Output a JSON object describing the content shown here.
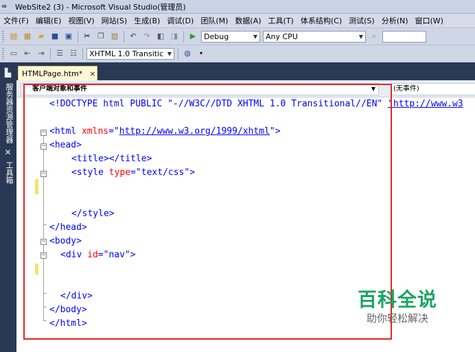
{
  "window": {
    "title": "WebSite2 (3) - Microsoft Visual Studio(管理员)"
  },
  "menu": [
    "文件(F)",
    "编辑(E)",
    "视图(V)",
    "网站(S)",
    "生成(B)",
    "调试(D)",
    "团队(M)",
    "数据(A)",
    "工具(T)",
    "体系结构(C)",
    "测试(S)",
    "分析(N)",
    "窗口(W)"
  ],
  "toolbar": {
    "config": "Debug",
    "platform": "Any CPU",
    "doctype": "XHTML 1.0 Transitic"
  },
  "sidebar": {
    "server_explorer": "服务器资源管理器",
    "toolbox": "工具箱"
  },
  "tab": {
    "label": "HTMLPage.htm*",
    "close": "×"
  },
  "nav": {
    "left": "客户端对象和事件",
    "right": "(无事件)"
  },
  "code": {
    "l1a": "<!DOCTYPE html PUBLIC \"-//W3C//DTD XHTML 1.0 Transitional//EN\" ",
    "l1b": "\"http://www.w3",
    "l3a": "<html ",
    "l3b": "xmlns",
    "l3c": "=\"",
    "l3d": "http://www.w3.org/1999/xhtml",
    "l3e": "\">",
    "l4": "<head>",
    "l5": "<title></title>",
    "l6a": "<style ",
    "l6b": "type",
    "l6c": "=\"text/css\">",
    "l9": "</style>",
    "l10": "</head>",
    "l11": "<body>",
    "l12a": "<div ",
    "l12b": "id",
    "l12c": "=\"nav\">",
    "l14": "</div>",
    "l15": "</body>",
    "l16": "</html>"
  },
  "watermark": {
    "title": "百科全说",
    "subtitle": "助你轻松解决"
  }
}
